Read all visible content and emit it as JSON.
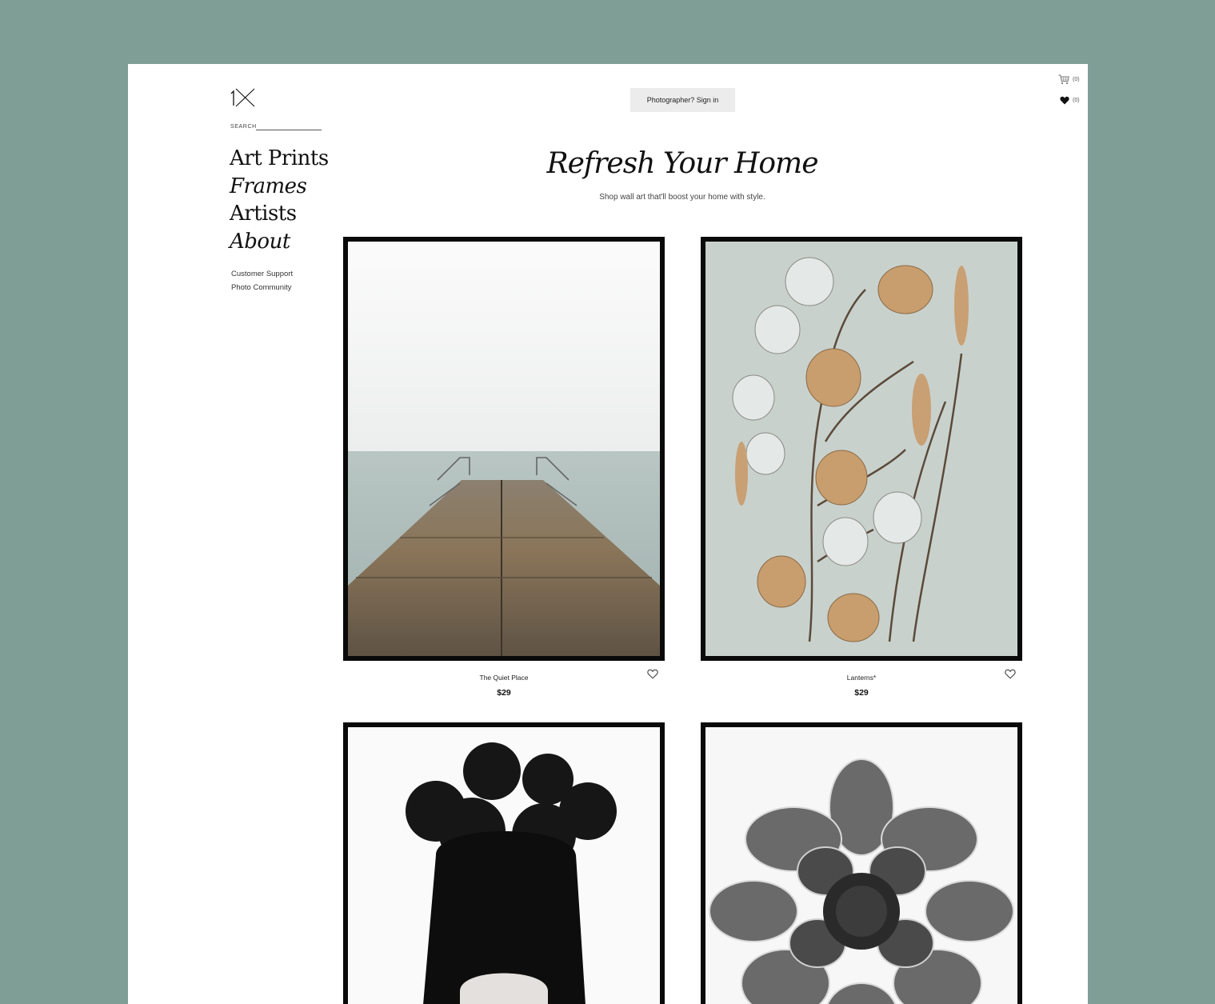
{
  "brand": {
    "logo_text": "1X"
  },
  "search": {
    "label": "SEARCH"
  },
  "nav": {
    "items": [
      {
        "label": "Art Prints"
      },
      {
        "label": "Frames"
      },
      {
        "label": "Artists"
      },
      {
        "label": "About"
      }
    ],
    "sub_links": [
      {
        "label": "Customer Support"
      },
      {
        "label": "Photo Community"
      }
    ]
  },
  "header": {
    "signin_label": "Photographer? Sign in",
    "cart_count": "(0)",
    "wishlist_count": "(0)"
  },
  "hero": {
    "title": "Refresh Your Home",
    "subtitle": "Shop wall art that'll boost your home with style."
  },
  "products": [
    {
      "title": "The Quiet Place",
      "price": "$29"
    },
    {
      "title": "Lanterns*",
      "price": "$29"
    }
  ],
  "colors": {
    "background": "#7e9e96",
    "page": "#ffffff",
    "frame": "#0a0a0a",
    "button_bg": "#ececec"
  }
}
